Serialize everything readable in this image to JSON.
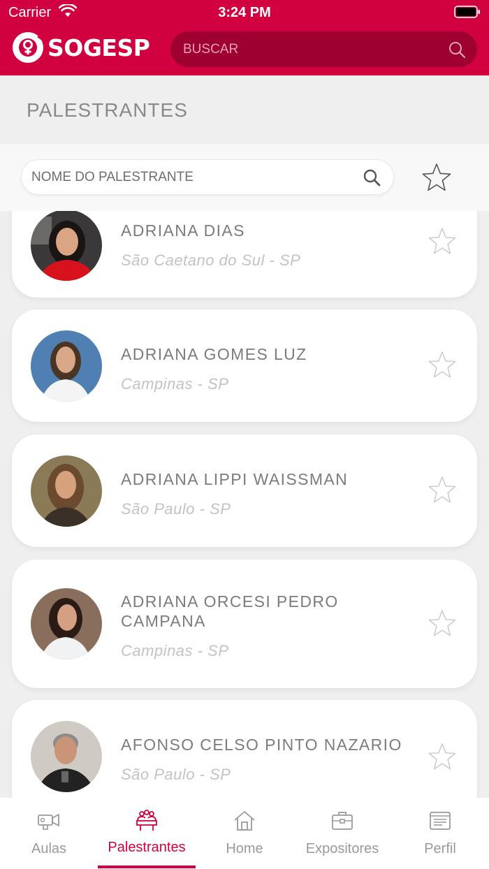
{
  "status_bar": {
    "carrier": "Carrier",
    "time": "3:24 PM"
  },
  "header": {
    "logo_text": "SOGESP",
    "search_placeholder": "BUSCAR"
  },
  "page": {
    "title": "PALESTRANTES",
    "filter_placeholder": "NOME DO PALESTRANTE"
  },
  "speakers": [
    {
      "name": "ADRIANA DIAS",
      "city": "São Caetano do Sul - SP",
      "favorite": false
    },
    {
      "name": "ADRIANA GOMES LUZ",
      "city": "Campinas - SP",
      "favorite": false
    },
    {
      "name": "ADRIANA LIPPI WAISSMAN",
      "city": "São Paulo - SP",
      "favorite": false
    },
    {
      "name": "ADRIANA ORCESI PEDRO CAMPANA",
      "city": "Campinas - SP",
      "favorite": false
    },
    {
      "name": "AFONSO CELSO PINTO NAZARIO",
      "city": "São Paulo - SP",
      "favorite": false
    }
  ],
  "tabs": [
    {
      "label": "Aulas",
      "icon": "video-camera-icon",
      "active": false
    },
    {
      "label": "Palestrantes",
      "icon": "speakers-icon",
      "active": true
    },
    {
      "label": "Home",
      "icon": "home-icon",
      "active": false
    },
    {
      "label": "Expositores",
      "icon": "briefcase-icon",
      "active": false
    },
    {
      "label": "Perfil",
      "icon": "profile-card-icon",
      "active": false
    }
  ],
  "colors": {
    "brand": "#d1003f",
    "search_bg": "#9e0030"
  }
}
